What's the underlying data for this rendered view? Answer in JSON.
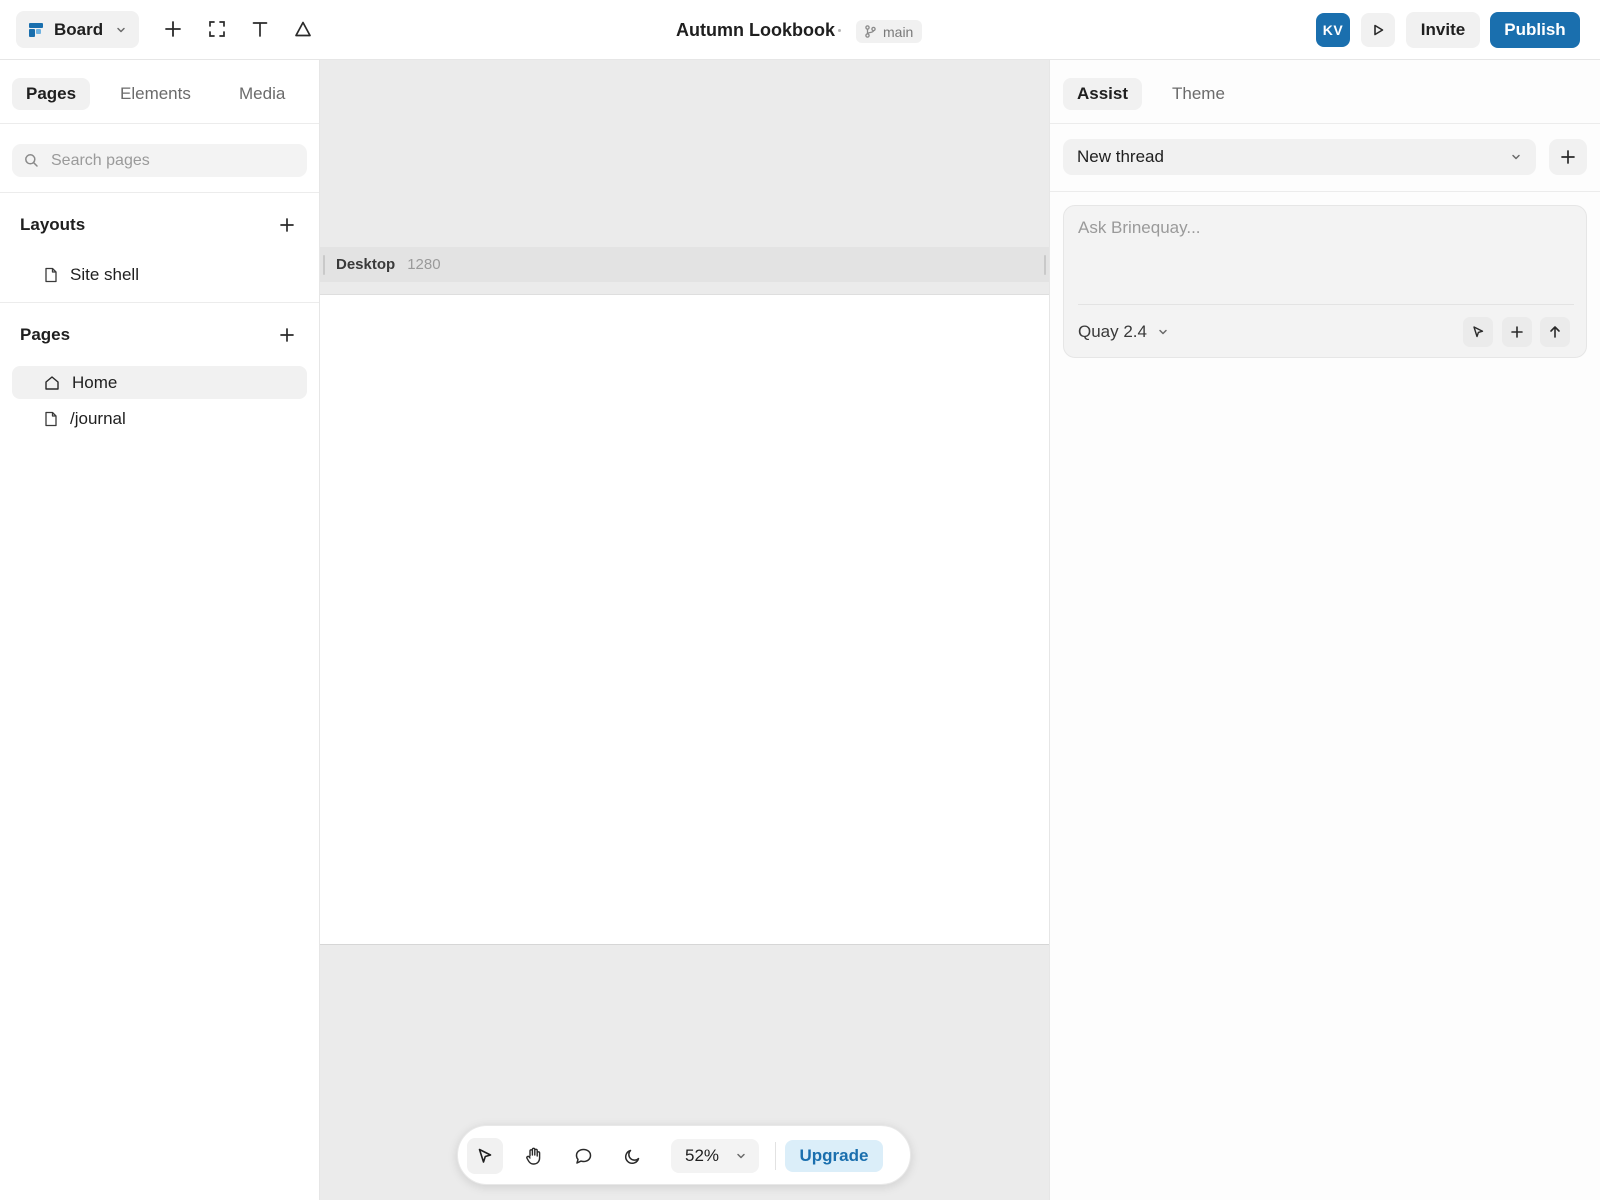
{
  "topbar": {
    "brand_label": "Board",
    "doc_title": "Autumn Lookbook",
    "branch": "main",
    "avatar_initials": "KV",
    "invite_label": "Invite",
    "publish_label": "Publish"
  },
  "left_panel": {
    "tabs": [
      {
        "label": "Pages",
        "active": true
      },
      {
        "label": "Elements",
        "active": false
      },
      {
        "label": "Media",
        "active": false
      }
    ],
    "search_placeholder": "Search pages",
    "layouts": {
      "title": "Layouts",
      "items": [
        {
          "label": "Site shell",
          "icon": "file-icon"
        }
      ]
    },
    "pages": {
      "title": "Pages",
      "items": [
        {
          "label": "Home",
          "icon": "home-icon",
          "selected": true
        },
        {
          "label": "/journal",
          "icon": "file-icon",
          "selected": false
        }
      ]
    }
  },
  "canvas": {
    "frame_name": "Desktop",
    "frame_width": "1280",
    "zoom": "52%",
    "upgrade_label": "Upgrade",
    "tools": [
      "pointer-icon",
      "hand-icon",
      "comment-icon",
      "moon-icon"
    ]
  },
  "right_panel": {
    "tabs": [
      {
        "label": "Assist",
        "active": true
      },
      {
        "label": "Theme",
        "active": false
      }
    ],
    "thread_selected": "New thread",
    "composer_placeholder": "Ask Brinequay...",
    "model": "Quay 2.4"
  },
  "colors": {
    "accent": "#1a6fae",
    "upgrade_bg": "#dbeef9",
    "canvas_bg": "#ebebeb"
  }
}
